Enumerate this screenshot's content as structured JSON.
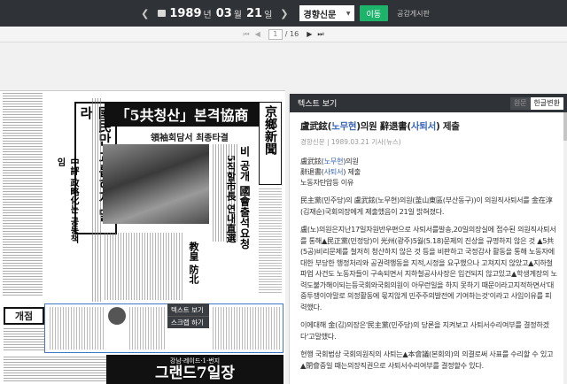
{
  "toolbar": {
    "year": "1989",
    "year_unit": "년",
    "month": "03",
    "month_unit": "월",
    "day": "21",
    "day_unit": "일",
    "newspaper": "경향신문",
    "move_label": "이동",
    "board_label": "공감게시판"
  },
  "pager": {
    "current_page": "1",
    "total_pages": "/ 16"
  },
  "newspaper_page": {
    "masthead": "京鄉新聞",
    "headline_main": "「5共청산」본격協商",
    "subheadline": "領袖회담서 최종타결",
    "left_headline": "國民만 괴롭히지 말라",
    "left_subhead": "中評 政略化는 공동책임",
    "right_headline": "비 공개 國會출석요청",
    "right_headline2": "5직할市長 연내直選",
    "mid_head": "教皇 防北",
    "ad_brand": "개점",
    "ad_bottom": "그랜드7일장",
    "ad_bottom_sub": "강남·레이드·1·번지"
  },
  "context_menu": {
    "item_text_view": "텍스트 보기",
    "item_scrap": "스크랩 하기"
  },
  "text_panel": {
    "title": "텍스트 보기",
    "tab_original": "원문",
    "tab_korean": "한글변환",
    "article_title_a": "盧武鉉(",
    "article_title_b": "노무현",
    "article_title_c": ")의원 辭退書(",
    "article_title_d": "사퇴서",
    "article_title_e": ") 제출",
    "meta": "경향신문 | 1989.03.21 기사(뉴스)",
    "lead_1a": "盧武鉉(",
    "lead_1b": "노무현",
    "lead_1c": ")의원",
    "lead_2a": "辭退書(",
    "lead_2b": "사퇴서",
    "lead_2c": ") 제출",
    "lead_3": "노동자탄압등 이유",
    "p1": "民主黨(민주당)의 盧武鉉(노무현)의원(釜山東區(부산동구))이 의원직사퇴서를 金在淳(김재순)국회의장에게 제출했음이 21일 밝혀졌다.",
    "p2": "盧(노)의원은지난17일자원반우편으로 사퇴서를발송,20일의장실에 접수된 의원직사퇴서를 통해▲民正黨(민정당)이 光州(광주)5월(5.18)문제의 진상을 규명하지 않은 것 ▲5共(5공)비리문제를 철저히 청산하지 않은 것 등을 비판하고 국정감사 활동을 통해 노동자에 대한 부당한 행정처리와 공권력행동을 지적,시정을 요구했으나 고쳐지지 않았고▲지하철파업 사건도 노동자들이 구속되면서 지하철공사사장은 입건되지 않고있고▲학생계장의 노력도불가해이되는등국회와국회의원이 아무런일을 하지 못하기 때문이라고지적하면서'대중투쟁이야말로 의정활동에 몫지않게 민주주의발전에 기여하는것'이라고 사임이유를 피력했다.",
    "p3": "이에대해 金(김)의장은'民主黨(민주당)의 당론을 지켜보고 사퇴서수리여부를 결정하겠다'고말했다.",
    "p4": "현행 국회법상 국회의원직의 사퇴는▲本會議(본회의)의 의결로써 사표를 수리할 수 있고▲閉會중일 때는의장직권으로 사퇴서수리여부를 결정할수 있다."
  }
}
